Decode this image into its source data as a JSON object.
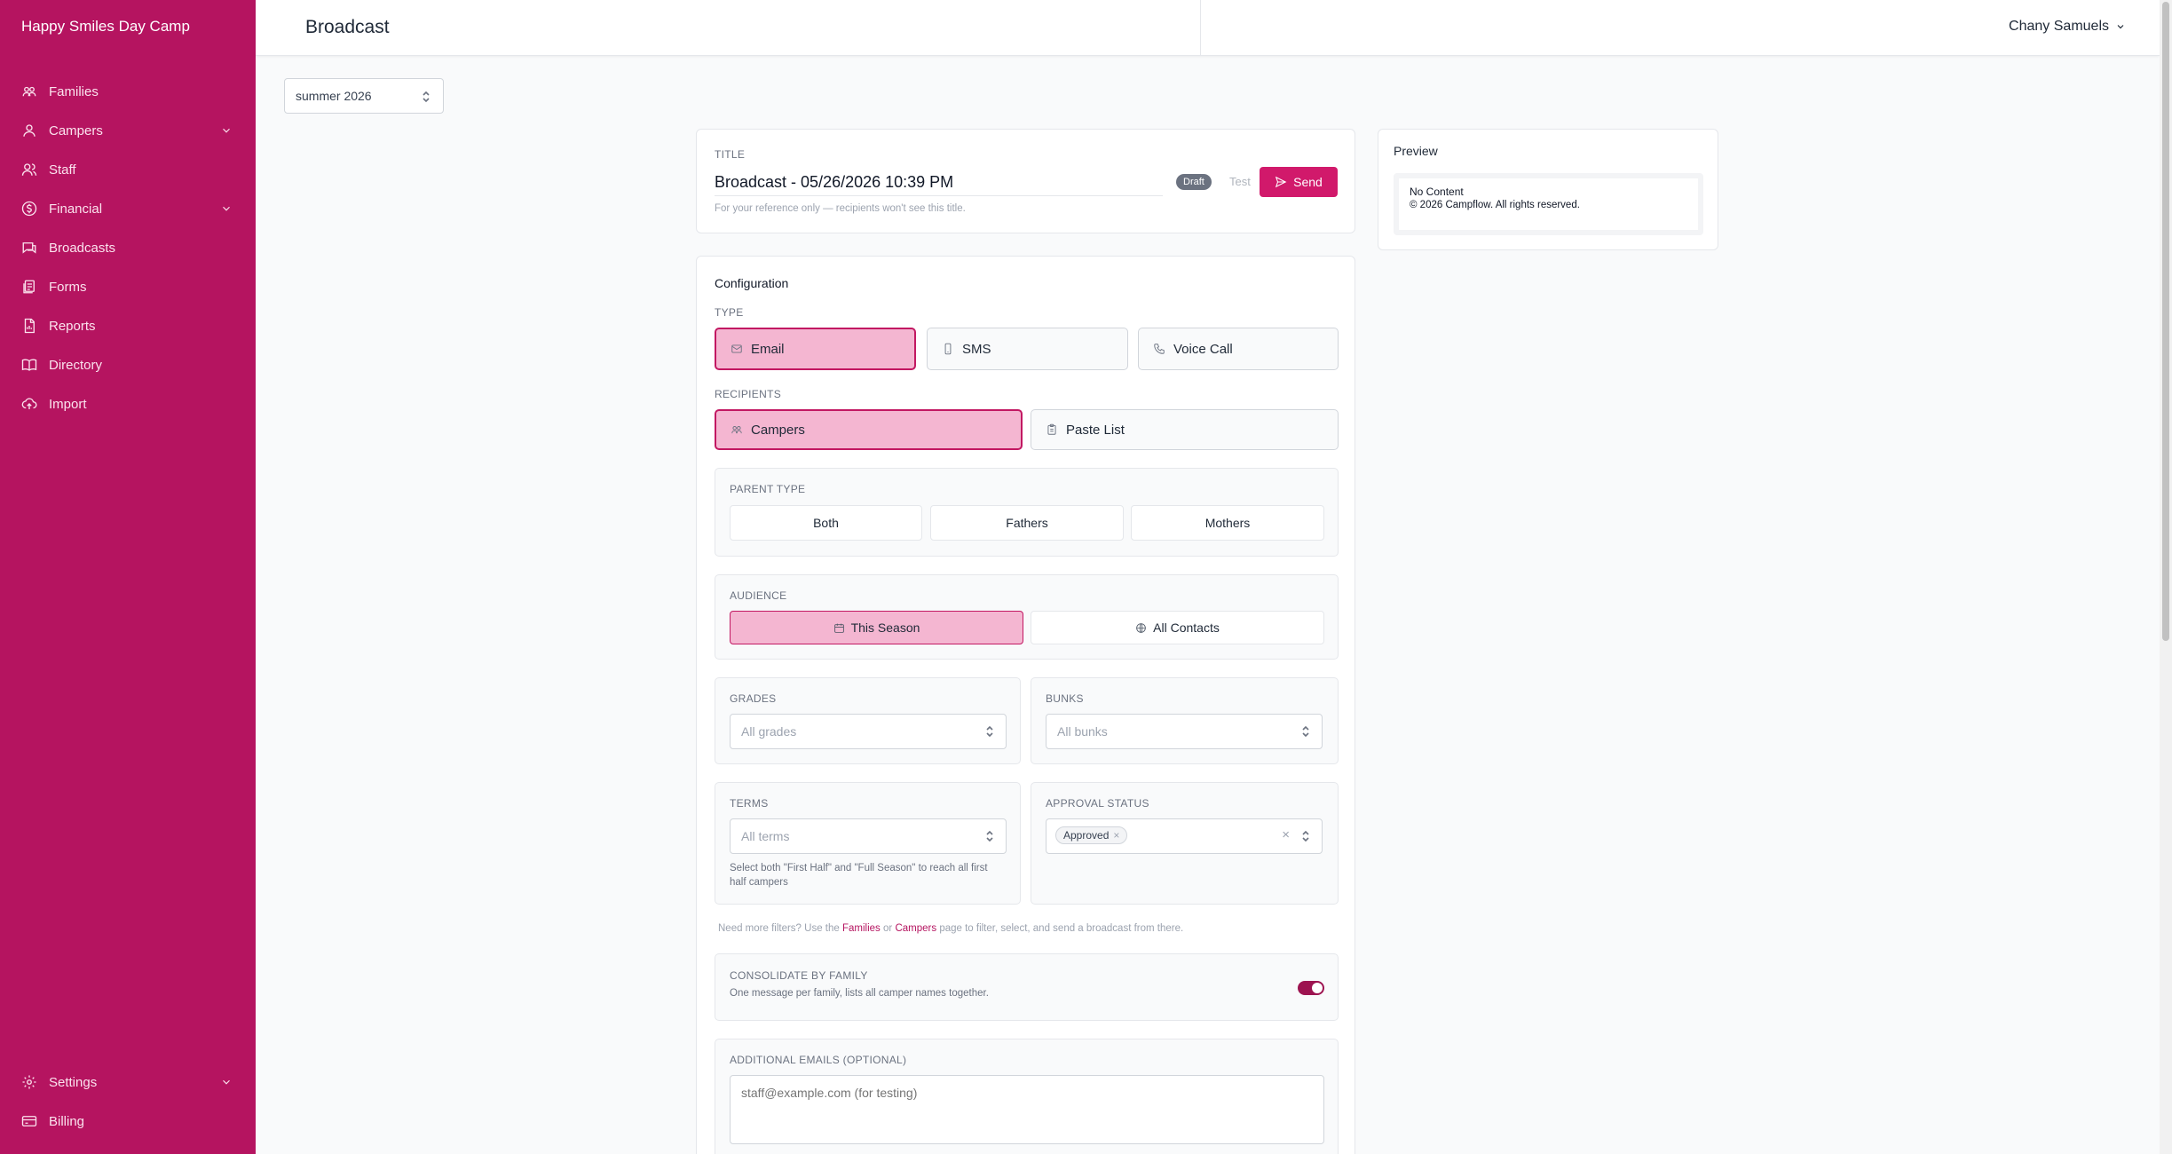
{
  "app": {
    "name": "Happy Smiles Day Camp"
  },
  "colors": {
    "brand": "#b51460",
    "accent": "#d1196b",
    "active_fill": "#f4b6d1"
  },
  "sidebar": {
    "items": [
      {
        "label": "Families",
        "icon": "families-icon"
      },
      {
        "label": "Campers",
        "icon": "user-icon",
        "expandable": true
      },
      {
        "label": "Staff",
        "icon": "users-icon"
      },
      {
        "label": "Financial",
        "icon": "dollar-icon",
        "expandable": true
      },
      {
        "label": "Broadcasts",
        "icon": "message-icon"
      },
      {
        "label": "Forms",
        "icon": "forms-icon"
      },
      {
        "label": "Reports",
        "icon": "report-icon"
      },
      {
        "label": "Directory",
        "icon": "book-icon"
      },
      {
        "label": "Import",
        "icon": "upload-cloud-icon"
      }
    ],
    "bottom": [
      {
        "label": "Settings",
        "icon": "gear-icon",
        "expandable": true
      },
      {
        "label": "Billing",
        "icon": "card-icon"
      }
    ]
  },
  "header": {
    "title": "Broadcast",
    "user": "Chany Samuels"
  },
  "season": {
    "selected": "summer 2026"
  },
  "title_card": {
    "label": "TITLE",
    "value": "Broadcast - 05/26/2026 10:39 PM",
    "helper": "For your reference only — recipients won't see this title.",
    "status": "Draft",
    "test_label": "Test",
    "send_label": "Send"
  },
  "config": {
    "heading": "Configuration",
    "type_label": "TYPE",
    "types": [
      {
        "label": "Email",
        "icon": "mail-icon",
        "active": true
      },
      {
        "label": "SMS",
        "icon": "phone-icon",
        "active": false
      },
      {
        "label": "Voice Call",
        "icon": "call-icon",
        "active": false
      }
    ],
    "recipients_label": "RECIPIENTS",
    "recipients": [
      {
        "label": "Campers",
        "icon": "campers-icon",
        "active": true
      },
      {
        "label": "Paste List",
        "icon": "clipboard-icon",
        "active": false
      }
    ],
    "parent_type": {
      "label": "PARENT TYPE",
      "options": [
        "Both",
        "Fathers",
        "Mothers"
      ]
    },
    "audience": {
      "label": "AUDIENCE",
      "options": [
        {
          "label": "This Season",
          "icon": "calendar-icon",
          "active": true
        },
        {
          "label": "All Contacts",
          "icon": "globe-icon",
          "active": false
        }
      ]
    },
    "grades": {
      "label": "GRADES",
      "placeholder": "All grades"
    },
    "bunks": {
      "label": "BUNKS",
      "placeholder": "All bunks"
    },
    "terms": {
      "label": "TERMS",
      "placeholder": "All terms",
      "helper": "Select both \"First Half\" and \"Full Season\" to reach all first half campers"
    },
    "approval": {
      "label": "APPROVAL STATUS",
      "chip": "Approved"
    },
    "filter_note": {
      "prefix": "Need more filters? Use the",
      "families": "Families",
      "or": "or",
      "campers": "Campers",
      "suffix": "page to filter, select, and send a broadcast from there."
    },
    "consolidate": {
      "label": "CONSOLIDATE BY FAMILY",
      "helper": "One message per family, lists all camper names together.",
      "enabled": true
    },
    "additional_emails": {
      "label": "ADDITIONAL EMAILS (OPTIONAL)",
      "placeholder": "staff@example.com (for testing)"
    }
  },
  "preview": {
    "heading": "Preview",
    "content": "No Content",
    "footer": "© 2026 Campflow. All rights reserved."
  }
}
